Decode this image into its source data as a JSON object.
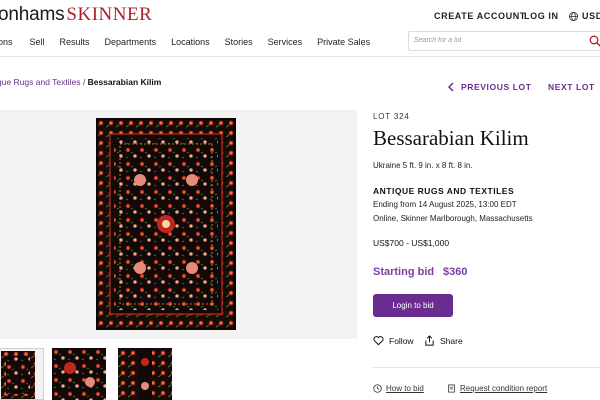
{
  "header": {
    "brand_primary": "onhams",
    "brand_secondary": "SKINNER",
    "create_account": "CREATE ACCOUNT",
    "log_in": "LOG IN",
    "currency": "USD"
  },
  "nav": {
    "items": [
      "ons",
      "Sell",
      "Results",
      "Departments",
      "Locations",
      "Stories",
      "Services",
      "Private Sales"
    ],
    "search_placeholder": "Search for a lot"
  },
  "breadcrumb": {
    "parent": "que Rugs and Textiles",
    "separator": " / ",
    "current": "Bessarabian Kilim"
  },
  "lot_nav": {
    "previous": "PREVIOUS LOT",
    "next": "NEXT LOT"
  },
  "lot": {
    "number": "LOT 324",
    "title": "Bessarabian Kilim",
    "dimensions": "Ukraine 5 ft. 9 in. x 8 ft. 8 in.",
    "department": "ANTIQUE RUGS AND TEXTILES",
    "ending": "Ending from 14 August 2025, 13:00 EDT",
    "location": "Online, Skinner Marlborough, Massachusetts",
    "estimate": "US$700 - US$1,000",
    "starting_bid_label": "Starting bid",
    "starting_bid_value": "$360",
    "login_to_bid": "Login to bid",
    "follow": "Follow",
    "share": "Share",
    "how_to_bid": "How to bid",
    "request_condition_report": "Request condition report"
  },
  "colors": {
    "accent": "#6b2c91",
    "brand_red": "#b0202a",
    "rug_ground": "#120a08",
    "rug_red": "#c0281f"
  },
  "icons": [
    "globe-icon",
    "search-icon",
    "chevron-left-icon",
    "chevron-right-icon",
    "heart-icon",
    "share-icon",
    "clock-icon",
    "document-icon"
  ]
}
